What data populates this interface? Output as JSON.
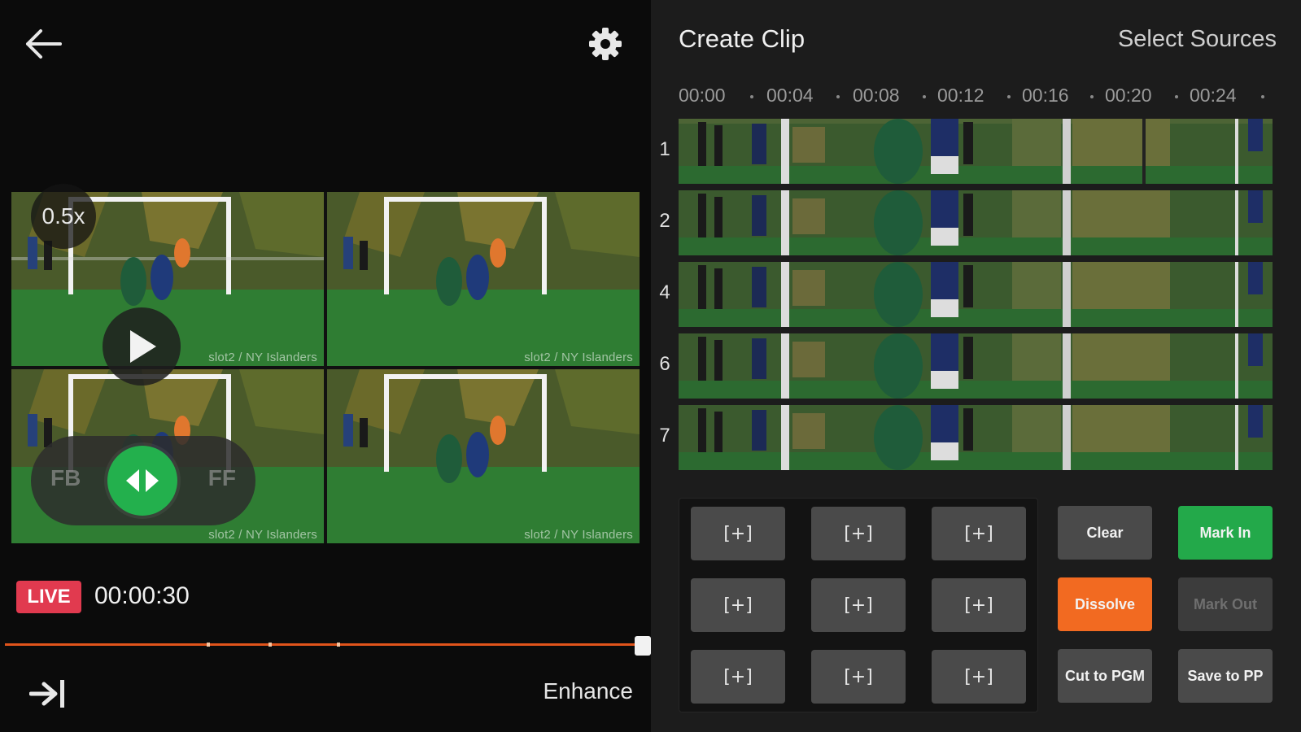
{
  "left": {
    "speed": "0.5x",
    "cams": [
      {
        "caption": "slot2 / NY Islanders"
      },
      {
        "caption": "slot2 / NY Islanders"
      },
      {
        "caption": "slot2 / NY Islanders"
      },
      {
        "caption": "slot2 / NY Islanders"
      }
    ],
    "seek": {
      "fb_label": "FB",
      "ff_label": "FF"
    },
    "live_label": "LIVE",
    "timecode": "00:00:30",
    "enhance_label": "Enhance"
  },
  "right": {
    "title": "Create Clip",
    "select_sources": "Select Sources",
    "ruler": [
      "00:00",
      "00:04",
      "00:08",
      "00:12",
      "00:16",
      "00:20",
      "00:24"
    ],
    "tracks": [
      "1",
      "2",
      "4",
      "6",
      "7"
    ],
    "placeholder_label": "[+]",
    "buttons": {
      "clear": "Clear",
      "mark_in": "Mark In",
      "dissolve": "Dissolve",
      "mark_out": "Mark Out",
      "cut_to_pgm": "Cut to PGM",
      "save_to_pp": "Save to PP"
    }
  },
  "colors": {
    "live": "#e13a4f",
    "scrub": "#e0541b",
    "mark_in": "#23a94a",
    "dissolve": "#f26a21",
    "seek_knob": "#23b04d"
  }
}
